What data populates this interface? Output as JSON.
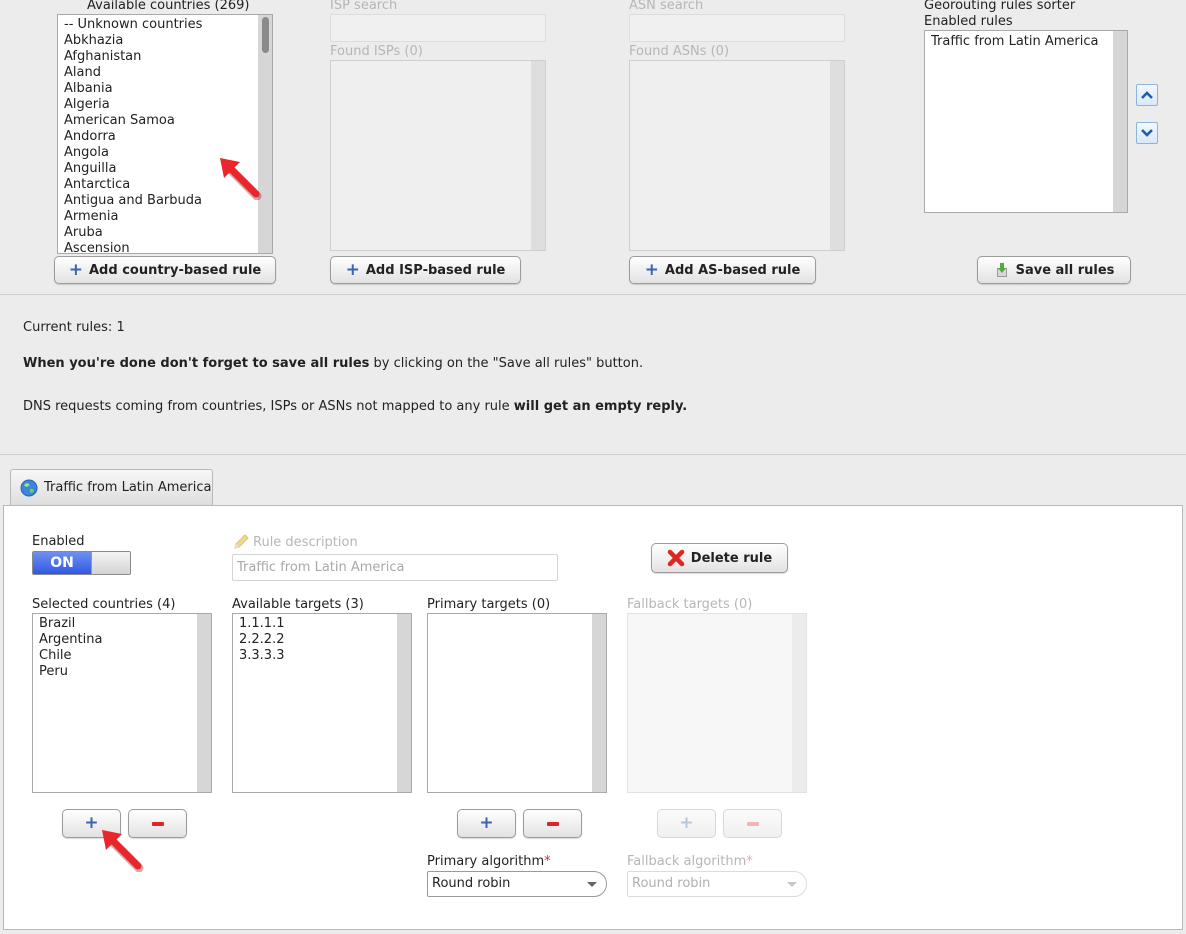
{
  "countries": {
    "label": "Available countries (269)",
    "items": [
      "-- Unknown countries",
      "Abkhazia",
      "Afghanistan",
      "Aland",
      "Albania",
      "Algeria",
      "American Samoa",
      "Andorra",
      "Angola",
      "Anguilla",
      "Antarctica",
      "Antigua and Barbuda",
      "Armenia",
      "Aruba",
      "Ascension"
    ],
    "add_button": "Add country-based rule"
  },
  "isp": {
    "search_label": "ISP search",
    "found_label": "Found ISPs (0)",
    "add_button": "Add ISP-based rule"
  },
  "asn": {
    "search_label": "ASN search",
    "found_label": "Found ASNs (0)",
    "add_button": "Add AS-based rule"
  },
  "sorter": {
    "title": "Georouting rules sorter",
    "enabled_label": "Enabled rules",
    "items": [
      "Traffic from Latin America"
    ],
    "save_button": "Save all rules"
  },
  "info": {
    "current_rules_label": "Current rules:",
    "current_rules_count": "1",
    "save_reminder_bold": "When you're done don't forget to save all rules",
    "save_reminder_rest": " by clicking on the \"Save all rules\" button.",
    "empty_reply_text": "DNS requests coming from countries, ISPs or ASNs not mapped to any rule ",
    "empty_reply_bold": "will get an empty reply."
  },
  "rule_tab": {
    "label": "Traffic from Latin America"
  },
  "rule": {
    "enabled_label": "Enabled",
    "toggle_on": "ON",
    "description_label": "Rule description",
    "description_value": "Traffic from Latin America",
    "delete_button": "Delete rule",
    "selected_countries_label": "Selected countries (4)",
    "selected_countries": [
      "Brazil",
      "Argentina",
      "Chile",
      "Peru"
    ],
    "available_targets_label": "Available targets (3)",
    "available_targets": [
      "1.1.1.1",
      "2.2.2.2",
      "3.3.3.3"
    ],
    "primary_targets_label": "Primary targets (0)",
    "fallback_targets_label": "Fallback targets (0)",
    "add_symbol": "+",
    "primary_algorithm_label": "Primary algorithm",
    "primary_algorithm_value": "Round robin",
    "fallback_algorithm_label": "Fallback algorithm",
    "fallback_algorithm_value": "Round robin",
    "required_mark": "*"
  },
  "colors": {
    "accent_blue": "#3159e0",
    "remove_red": "#d9262b",
    "annotation_arrow": "#e8262c"
  }
}
